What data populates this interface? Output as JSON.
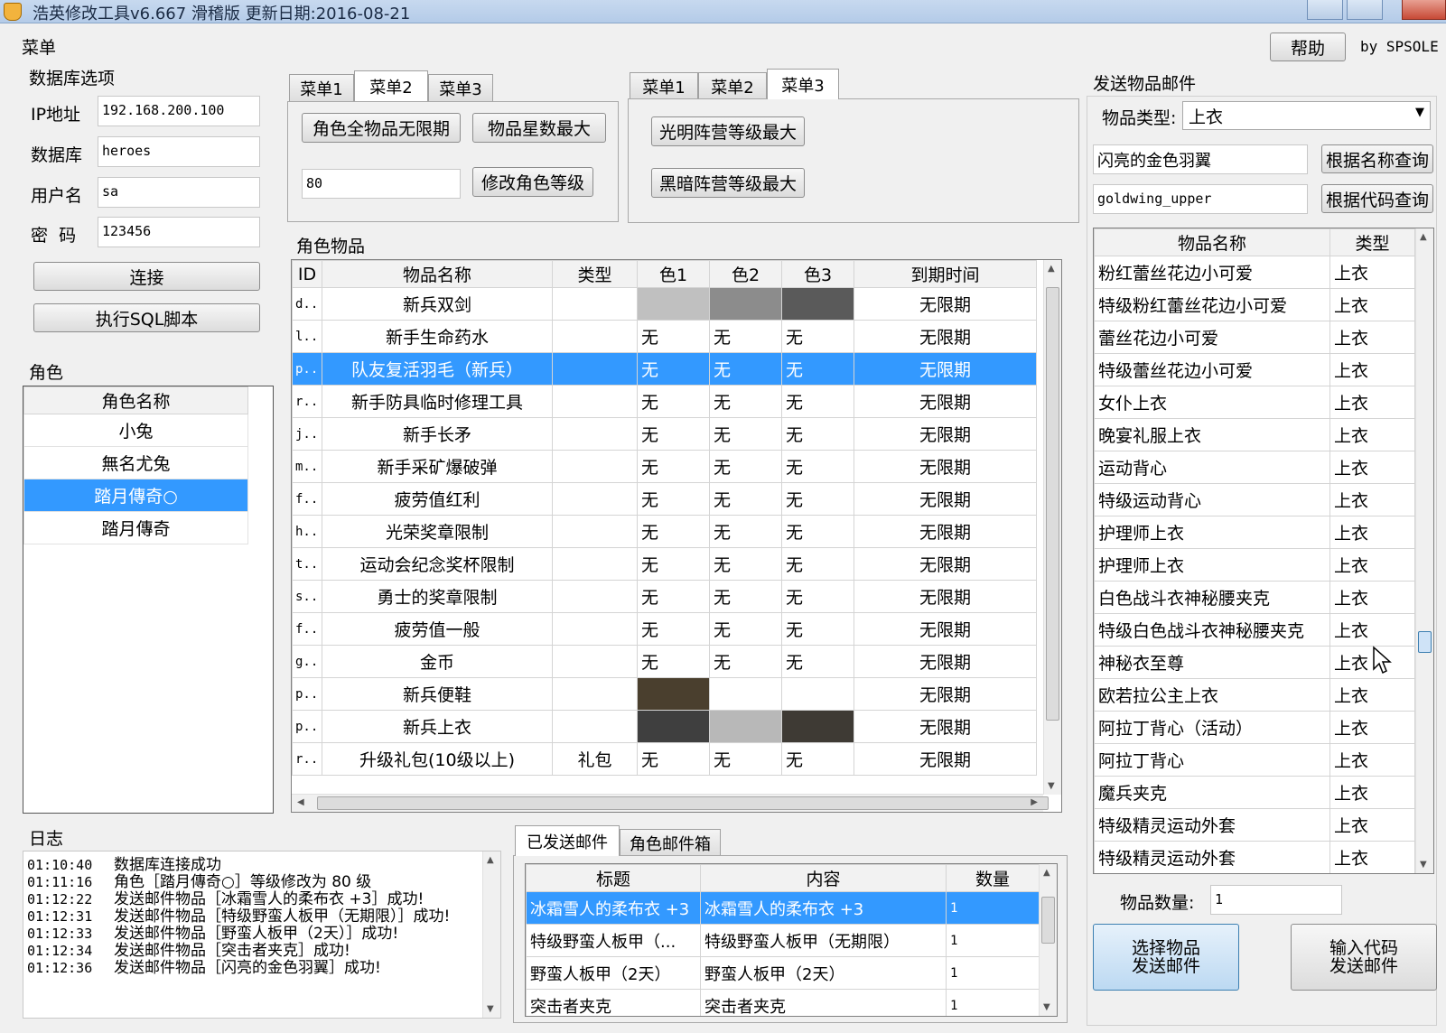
{
  "window": {
    "title": "浩英修改工具v6.667 滑稽版 更新日期:2016-08-21"
  },
  "menu_label": "菜单",
  "help_label": "帮助",
  "author": "by SPSOLE",
  "db": {
    "section": "数据库选项",
    "ip_label": "IP地址",
    "ip_value": "192.168.200.100",
    "db_label": "数据库",
    "db_value": "heroes",
    "user_label": "用户名",
    "user_value": "sa",
    "pwd_label": "密  码",
    "pwd_value": "123456",
    "connect": "连接",
    "run_sql": "执行SQL脚本"
  },
  "tabs_a": [
    "菜单1",
    "菜单2",
    "菜单3"
  ],
  "tabs_b": [
    "菜单1",
    "菜单2",
    "菜单3"
  ],
  "menu2": {
    "all_unlimited": "角色全物品无限期",
    "max_star": "物品星数最大",
    "level_value": "80",
    "modify_level": "修改角色等级"
  },
  "menu3": {
    "light_max": "光明阵营等级最大",
    "dark_max": "黑暗阵营等级最大"
  },
  "roles": {
    "section": "角色",
    "header": "角色名称",
    "items": [
      "小兔",
      "無名尤兔",
      "踏月傳奇○",
      "踏月傳奇"
    ],
    "selected": 2
  },
  "items": {
    "section": "角色物品",
    "headers": [
      "ID",
      "物品名称",
      "类型",
      "色1",
      "色2",
      "色3",
      "到期时间"
    ],
    "selected": 2,
    "rows": [
      {
        "id": "d..",
        "name": "新兵双剑",
        "type": "",
        "c1": "",
        "c2": "",
        "c3": "",
        "exp": "无限期",
        "sw": [
          "#c0c0c0",
          "#8c8c8c",
          "#5a5a5a"
        ]
      },
      {
        "id": "l..",
        "name": "新手生命药水",
        "type": "",
        "c1": "无",
        "c2": "无",
        "c3": "无",
        "exp": "无限期",
        "sw": [
          "",
          "",
          ""
        ]
      },
      {
        "id": "p..",
        "name": "队友复活羽毛（新兵）",
        "type": "",
        "c1": "无",
        "c2": "无",
        "c3": "无",
        "exp": "无限期",
        "sw": [
          "",
          "",
          ""
        ]
      },
      {
        "id": "r..",
        "name": "新手防具临时修理工具",
        "type": "",
        "c1": "无",
        "c2": "无",
        "c3": "无",
        "exp": "无限期",
        "sw": [
          "",
          "",
          ""
        ]
      },
      {
        "id": "j..",
        "name": "新手长矛",
        "type": "",
        "c1": "无",
        "c2": "无",
        "c3": "无",
        "exp": "无限期",
        "sw": [
          "",
          "",
          ""
        ]
      },
      {
        "id": "m..",
        "name": "新手采矿爆破弹",
        "type": "",
        "c1": "无",
        "c2": "无",
        "c3": "无",
        "exp": "无限期",
        "sw": [
          "",
          "",
          ""
        ]
      },
      {
        "id": "f..",
        "name": "疲劳值红利",
        "type": "",
        "c1": "无",
        "c2": "无",
        "c3": "无",
        "exp": "无限期",
        "sw": [
          "",
          "",
          ""
        ]
      },
      {
        "id": "h..",
        "name": "光荣奖章限制",
        "type": "",
        "c1": "无",
        "c2": "无",
        "c3": "无",
        "exp": "无限期",
        "sw": [
          "",
          "",
          ""
        ]
      },
      {
        "id": "t..",
        "name": "运动会纪念奖杯限制",
        "type": "",
        "c1": "无",
        "c2": "无",
        "c3": "无",
        "exp": "无限期",
        "sw": [
          "",
          "",
          ""
        ]
      },
      {
        "id": "s..",
        "name": "勇士的奖章限制",
        "type": "",
        "c1": "无",
        "c2": "无",
        "c3": "无",
        "exp": "无限期",
        "sw": [
          "",
          "",
          ""
        ]
      },
      {
        "id": "f..",
        "name": "疲劳值一般",
        "type": "",
        "c1": "无",
        "c2": "无",
        "c3": "无",
        "exp": "无限期",
        "sw": [
          "",
          "",
          ""
        ]
      },
      {
        "id": "g..",
        "name": "金币",
        "type": "",
        "c1": "无",
        "c2": "无",
        "c3": "无",
        "exp": "无限期",
        "sw": [
          "",
          "",
          ""
        ]
      },
      {
        "id": "p..",
        "name": "新兵便鞋",
        "type": "",
        "c1": "",
        "c2": "",
        "c3": "",
        "exp": "无限期",
        "sw": [
          "#4a3f2e",
          "#ffffff",
          "#ffffff"
        ]
      },
      {
        "id": "p..",
        "name": "新兵上衣",
        "type": "",
        "c1": "",
        "c2": "",
        "c3": "",
        "exp": "无限期",
        "sw": [
          "#3f3f3f",
          "#b8b8b8",
          "#3e3a34"
        ]
      },
      {
        "id": "r..",
        "name": "升级礼包(10级以上)",
        "type": "礼包",
        "c1": "无",
        "c2": "无",
        "c3": "无",
        "exp": "无限期",
        "sw": [
          "",
          "",
          ""
        ]
      }
    ]
  },
  "log": {
    "section": "日志",
    "lines": [
      {
        "t": "01:10:40",
        "m": "数据库连接成功"
      },
      {
        "t": "01:11:16",
        "m": "角色［踏月傳奇○］等级修改为 80 级"
      },
      {
        "t": "01:12:22",
        "m": "发送邮件物品［冰霜雪人的柔布衣 +3］成功!"
      },
      {
        "t": "01:12:31",
        "m": "发送邮件物品［特级野蛮人板甲（无期限）］成功!"
      },
      {
        "t": "01:12:33",
        "m": "发送邮件物品［野蛮人板甲（2天）］成功!"
      },
      {
        "t": "01:12:34",
        "m": "发送邮件物品［突击者夹克］成功!"
      },
      {
        "t": "01:12:36",
        "m": "发送邮件物品［闪亮的金色羽翼］成功!"
      }
    ]
  },
  "mail_tabs": [
    "已发送邮件",
    "角色邮件箱"
  ],
  "mail": {
    "headers": [
      "标题",
      "内容",
      "数量"
    ],
    "selected": 0,
    "rows": [
      {
        "title": "冰霜雪人的柔布衣 +3",
        "content": "冰霜雪人的柔布衣 +3",
        "qty": "1"
      },
      {
        "title": "特级野蛮人板甲（...",
        "content": "特级野蛮人板甲（无期限）",
        "qty": "1"
      },
      {
        "title": "野蛮人板甲（2天）",
        "content": "野蛮人板甲（2天）",
        "qty": "1"
      },
      {
        "title": "突击者夹克",
        "content": "突击者夹克",
        "qty": "1"
      }
    ]
  },
  "send": {
    "section": "发送物品邮件",
    "type_label": "物品类型:",
    "type_value": "上衣",
    "name_value": "闪亮的金色羽翼",
    "code_value": "goldwing_upper",
    "query_name": "根据名称查询",
    "query_code": "根据代码查询",
    "headers": [
      "物品名称",
      "类型"
    ],
    "rows": [
      {
        "name": "粉红蕾丝花边小可爱",
        "type": "上衣"
      },
      {
        "name": "特级粉红蕾丝花边小可爱",
        "type": "上衣"
      },
      {
        "name": "蕾丝花边小可爱",
        "type": "上衣"
      },
      {
        "name": "特级蕾丝花边小可爱",
        "type": "上衣"
      },
      {
        "name": "女仆上衣",
        "type": "上衣"
      },
      {
        "name": "晚宴礼服上衣",
        "type": "上衣"
      },
      {
        "name": "运动背心",
        "type": "上衣"
      },
      {
        "name": "特级运动背心",
        "type": "上衣"
      },
      {
        "name": "护理师上衣",
        "type": "上衣"
      },
      {
        "name": "护理师上衣",
        "type": "上衣"
      },
      {
        "name": "白色战斗衣神秘腰夹克",
        "type": "上衣"
      },
      {
        "name": "特级白色战斗衣神秘腰夹克",
        "type": "上衣"
      },
      {
        "name": "神秘衣至尊",
        "type": "上衣"
      },
      {
        "name": "欧若拉公主上衣",
        "type": "上衣"
      },
      {
        "name": "阿拉丁背心（活动）",
        "type": "上衣"
      },
      {
        "name": "阿拉丁背心",
        "type": "上衣"
      },
      {
        "name": "魔兵夹克",
        "type": "上衣"
      },
      {
        "name": "特级精灵运动外套",
        "type": "上衣"
      },
      {
        "name": "特级精灵运动外套",
        "type": "上衣"
      }
    ],
    "qty_label": "物品数量:",
    "qty_value": "1",
    "select_send": "选择物品\n发送邮件",
    "code_send": "输入代码\n发送邮件"
  }
}
